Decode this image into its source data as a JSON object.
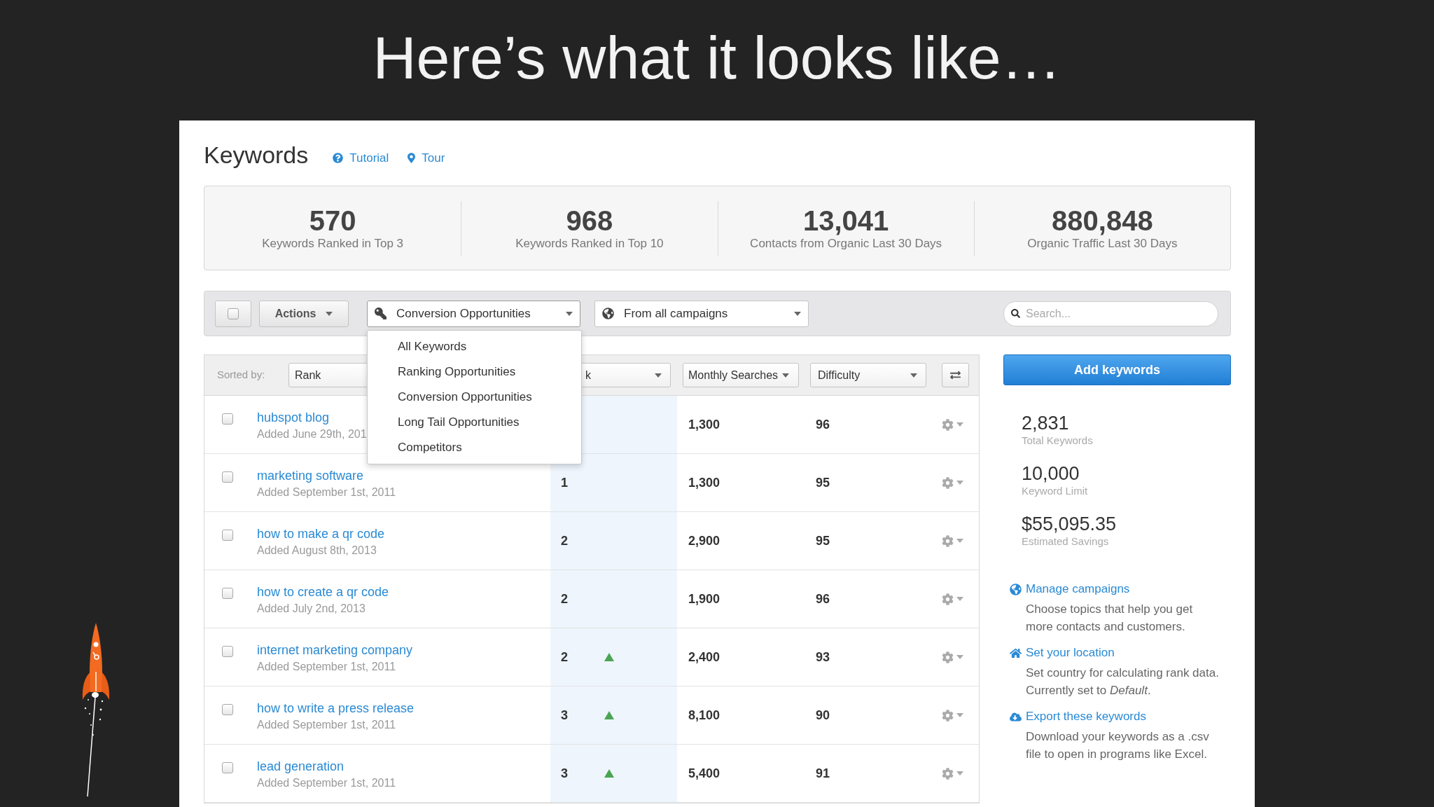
{
  "slide": {
    "title": "Here’s what it looks like…"
  },
  "header": {
    "title": "Keywords",
    "links": [
      {
        "kind": "help",
        "label": "Tutorial"
      },
      {
        "kind": "pin",
        "label": "Tour"
      }
    ]
  },
  "stats": [
    {
      "value": "570",
      "label": "Keywords Ranked in Top 3"
    },
    {
      "value": "968",
      "label": "Keywords Ranked in Top 10"
    },
    {
      "value": "13,041",
      "label": "Contacts from Organic Last 30 Days"
    },
    {
      "value": "880,848",
      "label": "Organic Traffic Last 30 Days"
    }
  ],
  "toolbar": {
    "select_all": {
      "checked": false
    },
    "actions": "Actions",
    "list_select": {
      "label": "Conversion Opportunities",
      "expanded": true,
      "options": [
        "All Keywords",
        "Ranking Opportunities",
        "Conversion Opportunities",
        "Long Tail Opportunities",
        "Competitors"
      ]
    },
    "campaign_select": {
      "label": "From all campaigns"
    },
    "search": {
      "placeholder": "Search..."
    }
  },
  "sort_bar": {
    "label": "Sorted by:",
    "selects": [
      {
        "kind": "plain",
        "label": "Rank"
      },
      {
        "kind": "select",
        "label": "k"
      },
      {
        "kind": "menu",
        "label": "Monthly Searches"
      },
      {
        "kind": "select",
        "label": "Difficulty"
      }
    ]
  },
  "rows": [
    {
      "checked": false,
      "keyword": "hubspot blog",
      "added": "Added June 29th, 201",
      "rank_up": false,
      "searches": "1,300",
      "difficulty": "96"
    },
    {
      "checked": false,
      "keyword": "marketing software",
      "added": "Added September 1st, 2011",
      "rank": "1",
      "rank_up": false,
      "searches": "1,300",
      "difficulty": "95"
    },
    {
      "checked": false,
      "keyword": "how to make a qr code",
      "added": "Added August 8th, 2013",
      "rank": "2",
      "rank_up": false,
      "searches": "2,900",
      "difficulty": "95"
    },
    {
      "checked": false,
      "keyword": "how to create a qr code",
      "added": "Added July 2nd, 2013",
      "rank": "2",
      "rank_up": false,
      "searches": "1,900",
      "difficulty": "96"
    },
    {
      "checked": false,
      "keyword": "internet marketing company",
      "added": "Added September 1st, 2011",
      "rank": "2",
      "rank_up": true,
      "searches": "2,400",
      "difficulty": "93"
    },
    {
      "checked": false,
      "keyword": "how to write a press release",
      "added": "Added September 1st, 2011",
      "rank": "3",
      "rank_up": true,
      "searches": "8,100",
      "difficulty": "90"
    },
    {
      "checked": false,
      "keyword": "lead generation",
      "added": "Added September 1st, 2011",
      "rank": "3",
      "rank_up": true,
      "searches": "5,400",
      "difficulty": "91"
    }
  ],
  "sidebar": {
    "add_button": "Add keywords",
    "totals": [
      {
        "value": "2,831",
        "label": "Total Keywords"
      },
      {
        "value": "10,000",
        "label": "Keyword Limit"
      },
      {
        "value": "$55,095.35",
        "label": "Estimated Savings"
      }
    ],
    "actions": [
      {
        "kind": "globe",
        "title": "Manage campaigns",
        "description": "Choose topics that help you get\nmore contacts and customers."
      },
      {
        "kind": "home",
        "title": "Set your location",
        "description": "Set country for calculating rank data.\nCurrently set to *Default*."
      },
      {
        "kind": "cloud",
        "title": "Export these keywords",
        "description": "Download your keywords as a .csv\nfile to open in programs like Excel."
      }
    ]
  }
}
